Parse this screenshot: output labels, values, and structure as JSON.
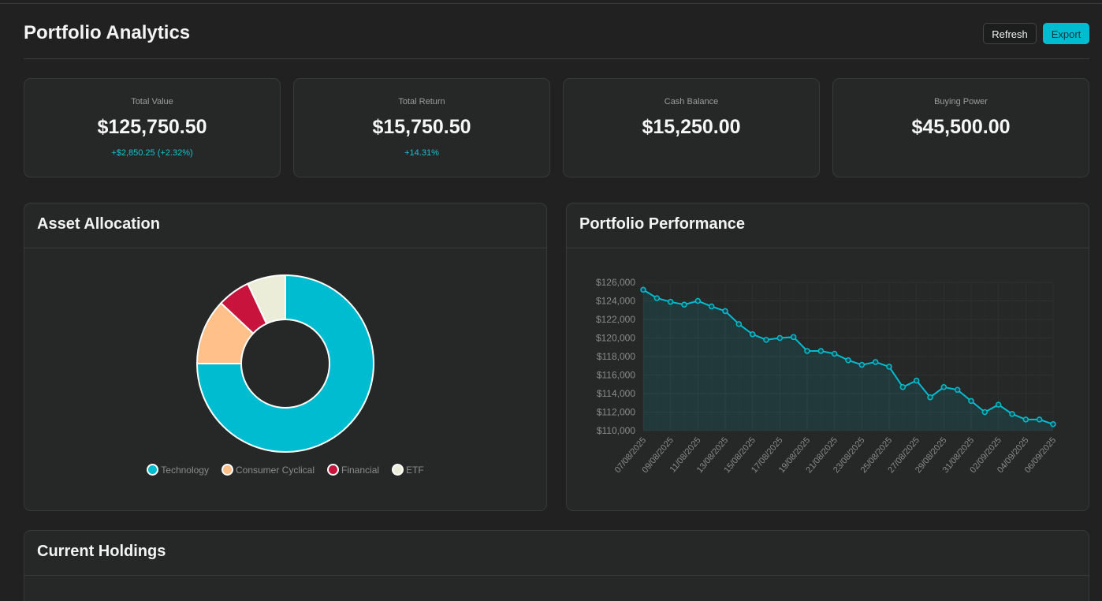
{
  "header": {
    "title": "Portfolio Analytics",
    "refresh_label": "Refresh",
    "export_label": "Export"
  },
  "stats": [
    {
      "label": "Total Value",
      "value": "$125,750.50",
      "change": "+$2,850.25 (+2.32%)"
    },
    {
      "label": "Total Return",
      "value": "$15,750.50",
      "change": "+14.31%"
    },
    {
      "label": "Cash Balance",
      "value": "$15,250.00",
      "change": ""
    },
    {
      "label": "Buying Power",
      "value": "$45,500.00",
      "change": ""
    }
  ],
  "allocation": {
    "title": "Asset Allocation"
  },
  "performance": {
    "title": "Portfolio Performance"
  },
  "holdings": {
    "title": "Current Holdings"
  },
  "colors": {
    "accent": "#00bcd0",
    "technology": "#00bcd0",
    "consumer_cyclical": "#ffc08a",
    "financial": "#c8143c",
    "etf": "#ecedd9"
  },
  "chart_data": [
    {
      "type": "pie",
      "variant": "doughnut",
      "categories": [
        "Technology",
        "Consumer Cyclical",
        "Financial",
        "ETF"
      ],
      "values": [
        75,
        12,
        6,
        7
      ],
      "legend_position": "bottom"
    },
    {
      "type": "line",
      "fill": true,
      "grid": true,
      "x": [
        "07/08/2025",
        "08/08/2025",
        "09/08/2025",
        "10/08/2025",
        "11/08/2025",
        "12/08/2025",
        "13/08/2025",
        "14/08/2025",
        "15/08/2025",
        "16/08/2025",
        "17/08/2025",
        "18/08/2025",
        "19/08/2025",
        "20/08/2025",
        "21/08/2025",
        "22/08/2025",
        "23/08/2025",
        "24/08/2025",
        "25/08/2025",
        "26/08/2025",
        "27/08/2025",
        "28/08/2025",
        "29/08/2025",
        "30/08/2025",
        "31/08/2025",
        "01/09/2025",
        "02/09/2025",
        "03/09/2025",
        "04/09/2025",
        "05/09/2025",
        "06/09/2025"
      ],
      "x_tick_labels": [
        "07/08/2025",
        "09/08/2025",
        "11/08/2025",
        "13/08/2025",
        "15/08/2025",
        "17/08/2025",
        "19/08/2025",
        "21/08/2025",
        "23/08/2025",
        "25/08/2025",
        "27/08/2025",
        "29/08/2025",
        "31/08/2025",
        "02/09/2025",
        "04/09/2025",
        "06/09/2025"
      ],
      "series": [
        {
          "values": [
            125200,
            124300,
            123900,
            123600,
            124000,
            123400,
            122900,
            121500,
            120400,
            119800,
            120000,
            120100,
            118600,
            118600,
            118300,
            117600,
            117100,
            117400,
            116900,
            114700,
            115400,
            113600,
            114700,
            114400,
            113200,
            112000,
            112800,
            111800,
            111200,
            111200,
            110700
          ]
        }
      ],
      "ylim": [
        110000,
        126000
      ],
      "y_ticks": [
        110000,
        112000,
        114000,
        116000,
        118000,
        120000,
        122000,
        124000,
        126000
      ],
      "y_tick_labels": [
        "$110,000",
        "$112,000",
        "$114,000",
        "$116,000",
        "$118,000",
        "$120,000",
        "$122,000",
        "$124,000",
        "$126,000"
      ],
      "legend_position": "none"
    }
  ]
}
